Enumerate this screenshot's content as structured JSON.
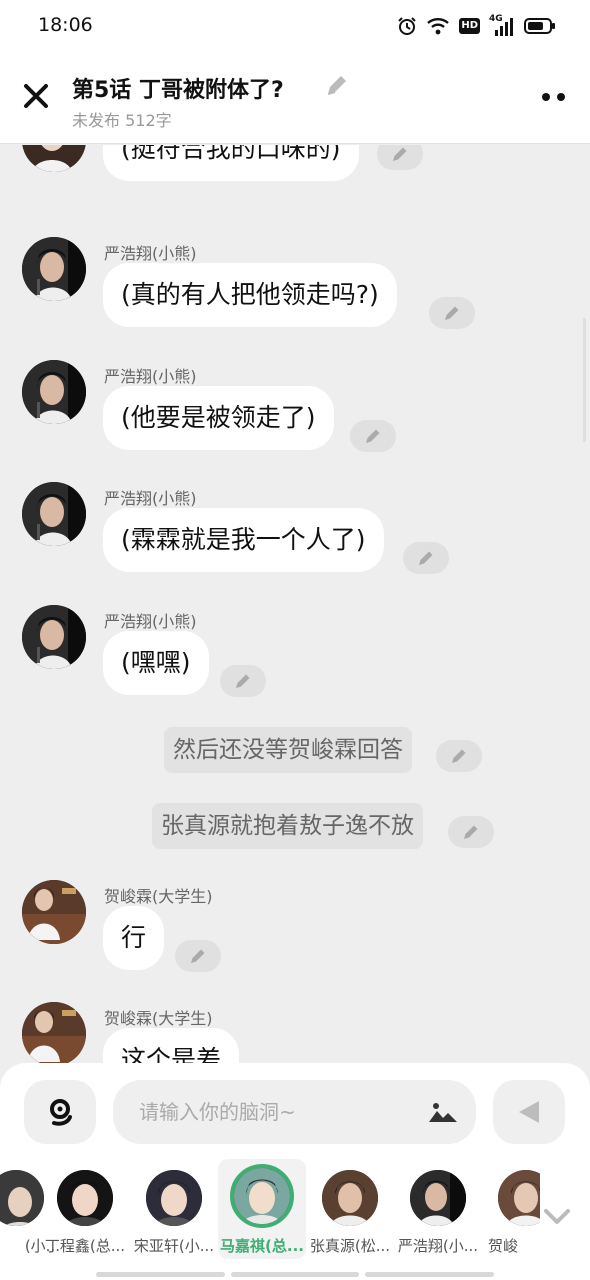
{
  "status_bar": {
    "time": "18:06",
    "network_badge": "HD",
    "network_type": "4G"
  },
  "header": {
    "title": "第5话  丁哥被附体了?",
    "meta": "未发布 512字"
  },
  "messages": [
    {
      "speaker": "",
      "text": "(挺符合我的口味的)"
    },
    {
      "speaker": "严浩翔(小熊)",
      "text": "(真的有人把他领走吗?)"
    },
    {
      "speaker": "严浩翔(小熊)",
      "text": "(他要是被领走了)"
    },
    {
      "speaker": "严浩翔(小熊)",
      "text": "(霖霖就是我一个人了)"
    },
    {
      "speaker": "严浩翔(小熊)",
      "text": "(嘿嘿)"
    },
    {
      "text": "然后还没等贺峻霖回答"
    },
    {
      "text": "张真源就抱着敖子逸不放"
    },
    {
      "speaker": "贺峻霖(大学生)",
      "text": "行"
    },
    {
      "speaker": "贺峻霖(大学生)",
      "text": "这个是差"
    }
  ],
  "composer": {
    "placeholder": "请输入你的脑洞~"
  },
  "characters": [
    {
      "name": "(小..."
    },
    {
      "name": "丁程鑫(总..."
    },
    {
      "name": "宋亚轩(小..."
    },
    {
      "name": "马嘉祺(总..."
    },
    {
      "name": "张真源(松..."
    },
    {
      "name": "严浩翔(小..."
    },
    {
      "name": "贺峻"
    }
  ],
  "colors": {
    "accent": "#3fae72",
    "background": "#eeeeee",
    "bubble": "#ffffff"
  }
}
